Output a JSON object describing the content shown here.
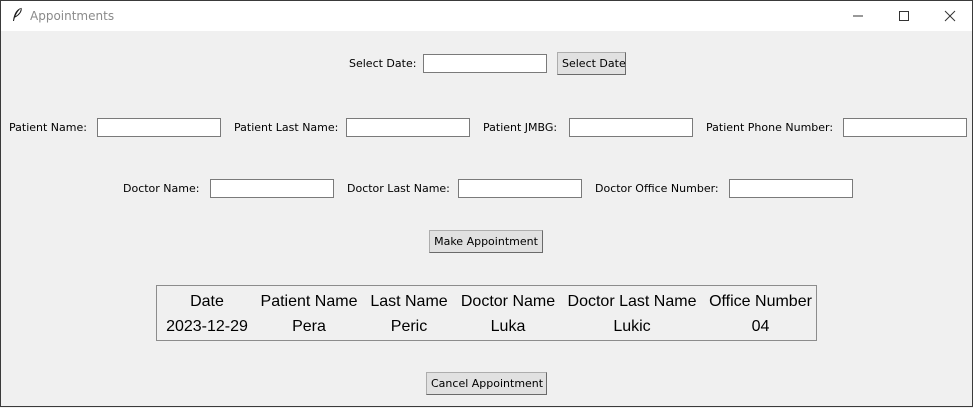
{
  "window": {
    "title": "Appointments",
    "icon": "feather-icon",
    "controls": [
      "minimize-icon",
      "maximize-icon",
      "close-icon"
    ]
  },
  "date_row": {
    "label": "Select Date:",
    "value": "",
    "button": "Select Date"
  },
  "patient_row": {
    "name_label": "Patient Name:",
    "name_value": "",
    "last_name_label": "Patient Last Name:",
    "last_name_value": "",
    "jmbg_label": "Patient JMBG:",
    "jmbg_value": "",
    "phone_label": "Patient Phone Number:",
    "phone_value": ""
  },
  "doctor_row": {
    "name_label": "Doctor Name:",
    "name_value": "",
    "last_name_label": "Doctor Last Name:",
    "last_name_value": "",
    "office_label": "Doctor Office Number:",
    "office_value": ""
  },
  "make_button": "Make Appointment",
  "cancel_button": "Cancel Appointment",
  "appointments_table": {
    "columns": [
      "Date",
      "Patient Name",
      "Last Name",
      "Doctor Name",
      "Doctor Last Name",
      "Office Number"
    ],
    "rows": [
      [
        "2023-12-29",
        "Pera",
        "Peric",
        "Luka",
        "Lukic",
        "04"
      ]
    ]
  }
}
